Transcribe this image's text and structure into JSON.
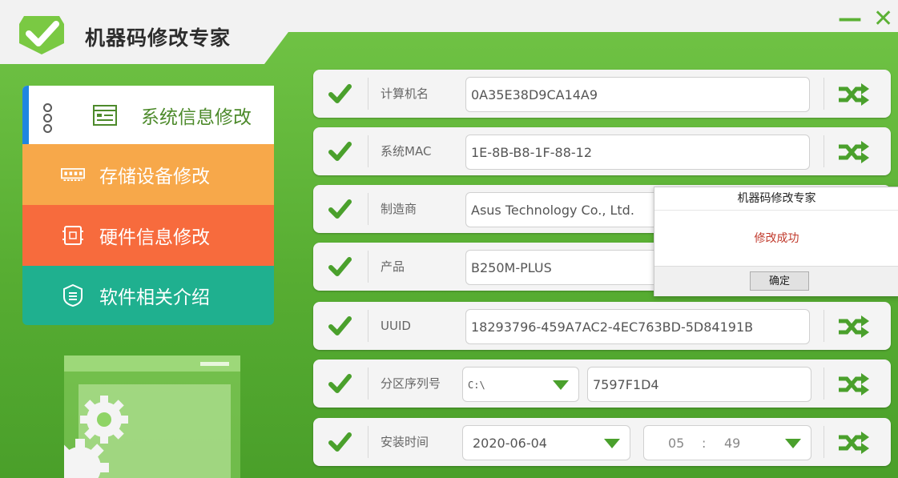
{
  "app": {
    "title": "机器码修改专家"
  },
  "window_controls": {
    "minimize": "—",
    "close": "✕"
  },
  "nav": [
    {
      "label": "系统信息修改",
      "icon": "system-info-icon",
      "active": true
    },
    {
      "label": "存储设备修改",
      "icon": "storage-icon"
    },
    {
      "label": "硬件信息修改",
      "icon": "chip-icon"
    },
    {
      "label": "软件相关介绍",
      "icon": "shield-info-icon"
    }
  ],
  "rows": {
    "computer_name": {
      "label": "计算机名",
      "value": "0A35E38D9CA14A9"
    },
    "mac": {
      "label": "系统MAC",
      "value": "1E-8B-B8-1F-88-12"
    },
    "manufacturer": {
      "label": "制造商",
      "value": "Asus Technology Co., Ltd."
    },
    "product": {
      "label": "产品",
      "value": "B250M-PLUS"
    },
    "uuid": {
      "label": "UUID",
      "value": "18293796-459A7AC2-4EC763BD-5D84191B"
    },
    "partition": {
      "label": "分区序列号",
      "drive": "C:\\",
      "value": "7597F1D4"
    },
    "install_time": {
      "label": "安装时间",
      "date": "2020-06-04",
      "hour": "05",
      "colon": ":",
      "minute": "49"
    }
  },
  "dialog": {
    "title": "机器码修改专家",
    "message": "修改成功",
    "ok": "确定"
  },
  "colors": {
    "brand_green": "#5cb135",
    "accent_blue": "#1f86e0",
    "nav_orange": "#f7a84a",
    "nav_red": "#f76b3d",
    "nav_teal": "#1fb08f"
  }
}
